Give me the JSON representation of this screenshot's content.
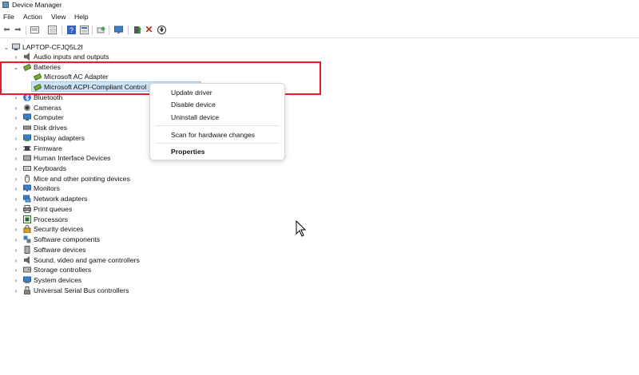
{
  "window": {
    "title": "Device Manager"
  },
  "menu": [
    "File",
    "Action",
    "View",
    "Help"
  ],
  "toolbar": {
    "icons": [
      "back-icon",
      "forward-icon",
      "properties-view-icon",
      "list-view-icon",
      "help-icon",
      "details-icon",
      "scan-hardware-icon",
      "monitor-icon",
      "update-driver-icon",
      "uninstall-icon",
      "disable-icon"
    ]
  },
  "tree": {
    "root": "LAPTOP-CFJQ5L2I",
    "batteries": {
      "label": "Batteries",
      "children": [
        "Microsoft AC Adapter",
        "Microsoft ACPI-Compliant Control"
      ]
    },
    "categories_before": [
      "Audio inputs and outputs"
    ],
    "categories_after": [
      "Bluetooth",
      "Cameras",
      "Computer",
      "Disk drives",
      "Display adapters",
      "Firmware",
      "Human Interface Devices",
      "Keyboards",
      "Mice and other pointing devices",
      "Monitors",
      "Network adapters",
      "Print queues",
      "Processors",
      "Security devices",
      "Software components",
      "Software devices",
      "Sound, video and game controllers",
      "Storage controllers",
      "System devices",
      "Universal Serial Bus controllers"
    ]
  },
  "context_menu": {
    "items": [
      "Update driver",
      "Disable device",
      "Uninstall device",
      "Scan for hardware changes",
      "Properties"
    ]
  },
  "colors": {
    "highlight_box": "#e0202a",
    "selection": "#cce4f7"
  }
}
